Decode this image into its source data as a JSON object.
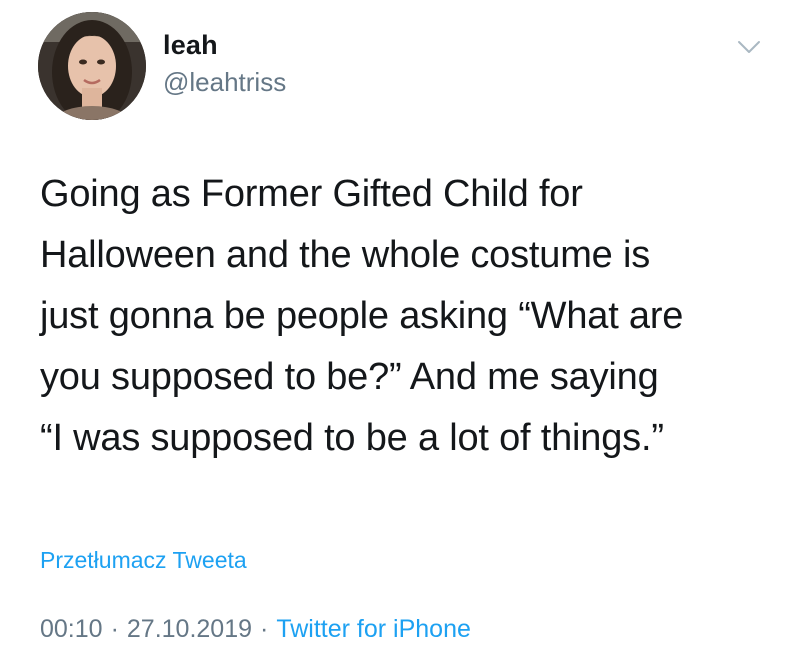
{
  "user": {
    "display_name": "leah",
    "handle": "@leahtriss",
    "avatar_icon": "profile-photo"
  },
  "tweet": {
    "text": "Going as Former Gifted Child for\nHalloween and the whole costume is\njust gonna be people asking “What are\nyou supposed to be?” And me saying\n“I was supposed to be a lot of things.”",
    "translate_label": "Przetłumacz Tweeta",
    "time": "00:10",
    "separator": "·",
    "date": "27.10.2019",
    "source": "Twitter for iPhone"
  },
  "icons": {
    "menu": "chevron-down-icon"
  },
  "colors": {
    "link": "#1da1f2",
    "secondary_text": "#657786",
    "primary_text": "#14171a"
  }
}
